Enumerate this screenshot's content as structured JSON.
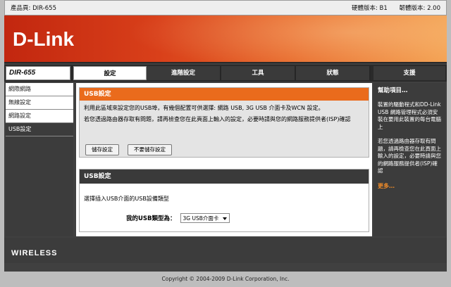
{
  "header": {
    "product_page": "產品頁: DIR-655",
    "hw_version": "硬體版本: B1",
    "fw_version": "韌體版本: 2.00"
  },
  "brand": {
    "logo_text": "D-Link",
    "model_badge": "DIR-655",
    "footer_mark": "WIRELESS"
  },
  "tabs": [
    {
      "label": "設定",
      "active": true
    },
    {
      "label": "進階設定"
    },
    {
      "label": "工具"
    },
    {
      "label": "狀態"
    }
  ],
  "help_tab": "支援",
  "sidebar": {
    "items": [
      {
        "label": "網際網路"
      },
      {
        "label": "無線設定"
      },
      {
        "label": "網路設定"
      },
      {
        "label": "USB設定",
        "active": true
      }
    ]
  },
  "usb_settings": {
    "title": "USB設定",
    "desc1": "利用此區域來設定您的USB埠，有幾個配置可供選擇: 網路 USB, 3G USB 介面卡及WCN 設定。",
    "desc2": "若您透過路由器存取有問題，請再檢查您在此頁面上輸入的設定，必要時請與您的網路服務提供者(ISP)確認",
    "save_label": "儲存設定",
    "nosave_label": "不要儲存設定"
  },
  "usb_type": {
    "title": "USB設定",
    "desc": "選擇插入USB介面的USB設備類型",
    "label": "我的USB類型為：",
    "value": "3G USB介面卡"
  },
  "help": {
    "title": "幫助項目…",
    "p1": "裝置的驅動程式和DD-Link USB 網路管理程式必須安裝在要用此裝置的每台電腦上",
    "p2": "若您透過路由器存取有問題，請再檢查您在此頁面上輸入的設定，必要時請與您的網路服務提供者(ISP)確認",
    "more": "更多…"
  },
  "copyright": "Copyright © 2004-2009 D-Link Corporation, Inc."
}
